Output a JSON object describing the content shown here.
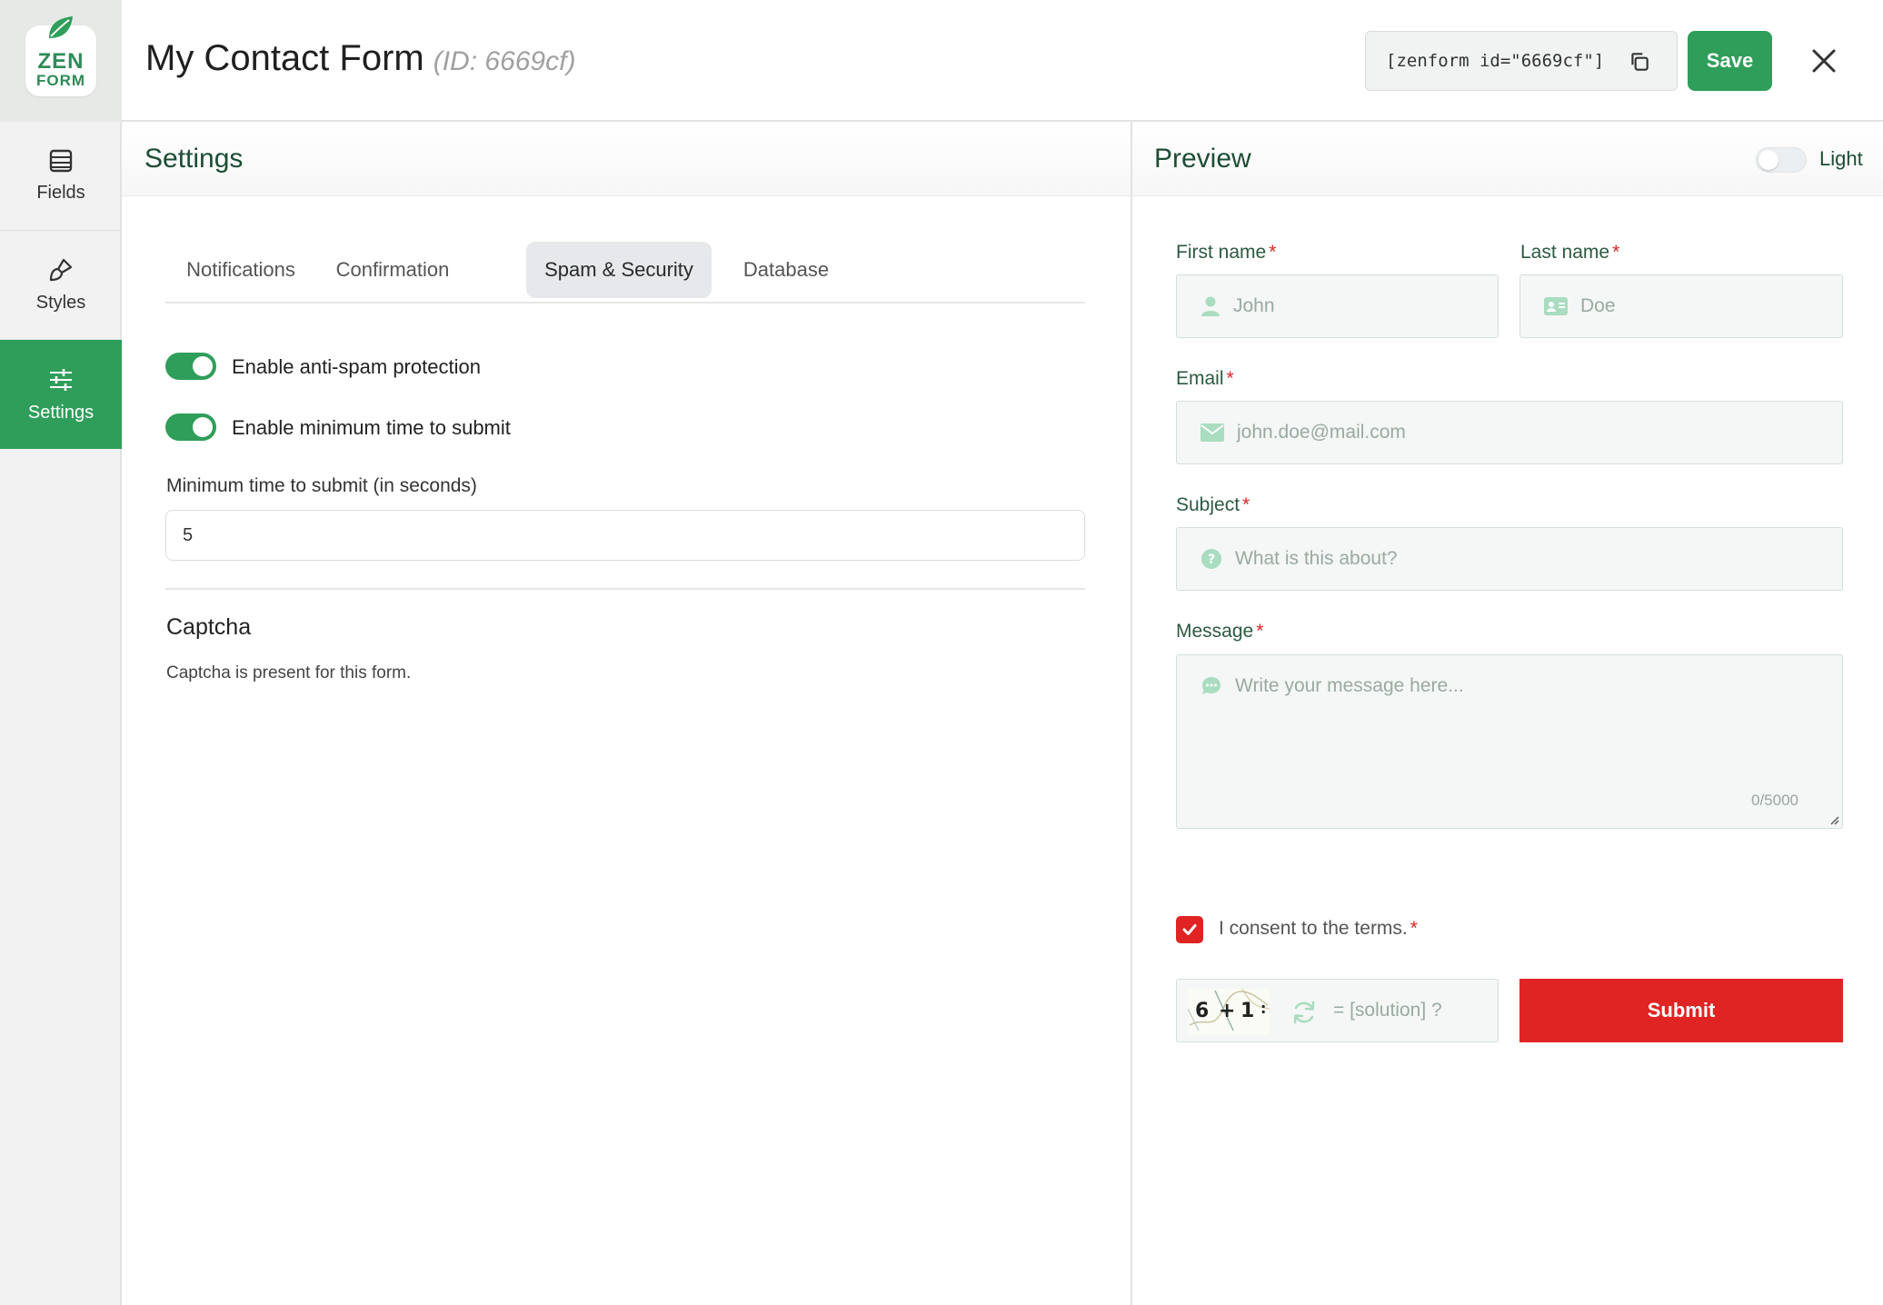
{
  "app": {
    "logo_line1": "ZEN",
    "logo_line2": "FORM",
    "brand_color": "#2f9e5a"
  },
  "header": {
    "form_name": "My Contact Form",
    "form_id": "(ID: 6669cf)",
    "shortcode": "[zenform id=\"6669cf\"]",
    "save_label": "Save"
  },
  "nav": {
    "items": [
      {
        "label": "Fields",
        "icon": "list-icon",
        "active": false
      },
      {
        "label": "Styles",
        "icon": "brush-icon",
        "active": false
      },
      {
        "label": "Settings",
        "icon": "sliders-icon",
        "active": true
      }
    ]
  },
  "settings": {
    "title": "Settings",
    "tabs": [
      "Notifications",
      "Confirmation",
      "Spam & Security",
      "Database"
    ],
    "active_tab": "Spam & Security",
    "toggles": [
      {
        "label": "Enable anti-spam protection",
        "on": true
      },
      {
        "label": "Enable minimum time to submit",
        "on": true
      }
    ],
    "min_time_label": "Minimum time to submit (in seconds)",
    "min_time_value": "5",
    "captcha_title": "Captcha",
    "captcha_text": "Captcha is present for this form."
  },
  "preview": {
    "title": "Preview",
    "theme_label": "Light",
    "fields": {
      "first_name": {
        "label": "First name",
        "required_mark": "*",
        "placeholder": "John"
      },
      "last_name": {
        "label": "Last name",
        "required_mark": "*",
        "placeholder": "Doe"
      },
      "email": {
        "label": "Email",
        "required_mark": "*",
        "placeholder": "john.doe@mail.com"
      },
      "subject": {
        "label": "Subject",
        "required_mark": "*",
        "placeholder": "What is this about?"
      },
      "message": {
        "label": "Message",
        "required_mark": "*",
        "placeholder": "Write your message here...",
        "counter": "0/5000"
      }
    },
    "consent": {
      "label": "I consent to the terms.",
      "required_mark": "*",
      "checked": true
    },
    "captcha": {
      "d1": "6",
      "op": "+",
      "d2": "1",
      "tail": ":",
      "placeholder": "= [solution] ?"
    },
    "submit_label": "Submit",
    "submit_color": "#e02424"
  }
}
